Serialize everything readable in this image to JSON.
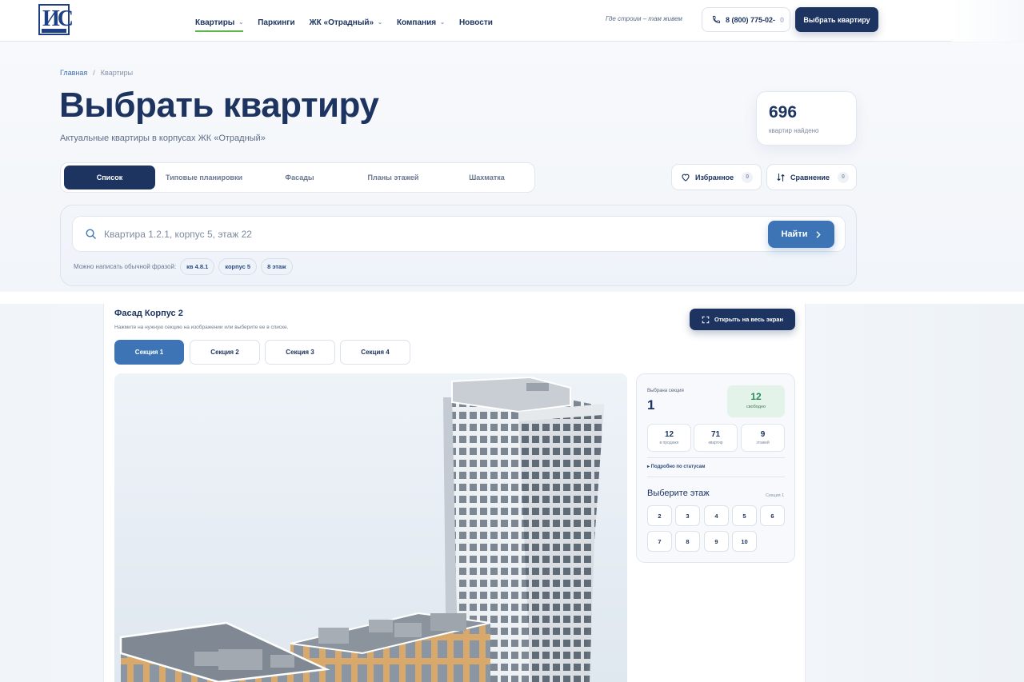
{
  "header": {
    "logo_text": "ИС",
    "nav": [
      {
        "label": "Квартиры",
        "dropdown": true,
        "active": true
      },
      {
        "label": "Паркинги",
        "dropdown": false
      },
      {
        "label": "ЖК «Отрадный»",
        "dropdown": true
      },
      {
        "label": "Компания",
        "dropdown": true
      },
      {
        "label": "Новости",
        "dropdown": false
      }
    ],
    "slogan": "Где строим – там живем",
    "phone": "8 (800) 775-02-",
    "phone_tail": "0",
    "cta": "Выбрать квартиру"
  },
  "breadcrumb": {
    "home": "Главная",
    "sep": "/",
    "current": "Квартиры"
  },
  "page": {
    "title": "Выбрать квартиру",
    "subtitle": "Актуальные квартиры в корпусах ЖК «Отрадный»",
    "count_value": "696",
    "count_label": "квартир найдено"
  },
  "view_tabs": [
    {
      "label": "Список",
      "active": true
    },
    {
      "label": "Типовые планировки"
    },
    {
      "label": "Фасады"
    },
    {
      "label": "Планы этажей"
    },
    {
      "label": "Шахматка"
    }
  ],
  "favorites": {
    "label": "Избранное",
    "count": "0"
  },
  "compare": {
    "label": "Сравнение",
    "count": "0"
  },
  "search": {
    "placeholder": "Квартира 1.2.1, корпус 5, этаж 22",
    "button": "Найти",
    "hint": "Можно написать обычной фразой:",
    "chips": [
      "кв 4.8.1",
      "корпус 5",
      "8 этаж"
    ]
  },
  "facade": {
    "title": "Фасад Корпус 2",
    "subtitle": "Нажмите на нужную секцию на изображении или выберите ее в списке.",
    "fullscreen": "Открыть на весь экран",
    "sections": [
      {
        "label": "Секция 1",
        "active": true
      },
      {
        "label": "Секция 2"
      },
      {
        "label": "Секция 3"
      },
      {
        "label": "Секция 4"
      }
    ]
  },
  "section_info": {
    "selected_label": "Выбрана секция",
    "selected_value": "1",
    "free_value": "12",
    "free_label": "свободно",
    "stats": [
      {
        "value": "12",
        "label": "в продаже"
      },
      {
        "value": "71",
        "label": "квартир"
      },
      {
        "value": "9",
        "label": "этажей"
      }
    ],
    "status_link": "▸ Подробно по статусам",
    "choose_floor": "Выберите этаж",
    "section_tag": "Секция 1",
    "floors": [
      "2",
      "3",
      "4",
      "5",
      "6",
      "7",
      "8",
      "9",
      "10"
    ]
  },
  "colors": {
    "primary": "#1d3461",
    "accent": "#3d74b5",
    "green": "#5db64c",
    "free_bg": "#e3f3ea"
  },
  "icons": [
    "phone-icon",
    "heart-icon",
    "compare-icon",
    "search-icon",
    "chevron-right-icon",
    "expand-icon",
    "chevron-down-icon"
  ]
}
